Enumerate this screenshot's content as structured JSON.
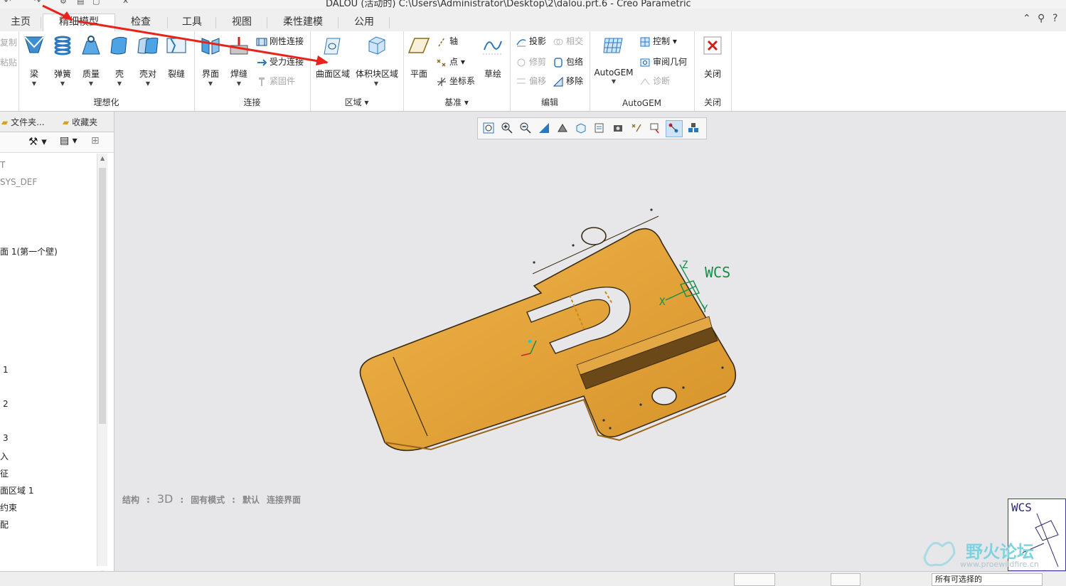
{
  "window": {
    "title": "DALOU (活动的) C:\\Users\\Administrator\\Desktop\\2\\dalou.prt.6 - Creo Parametric"
  },
  "tabs": [
    {
      "label": "主页"
    },
    {
      "label": "精细模型"
    },
    {
      "label": "检查"
    },
    {
      "label": "工具"
    },
    {
      "label": "视图"
    },
    {
      "label": "柔性建模"
    },
    {
      "label": "公用"
    }
  ],
  "ribbon": {
    "left_fragments": {
      "copy": "复制",
      "paste": "粘贴"
    },
    "idealize": {
      "group_label": "理想化",
      "buttons": [
        {
          "label": "梁"
        },
        {
          "label": "弹簧"
        },
        {
          "label": "质量"
        },
        {
          "label": "壳"
        },
        {
          "label": "壳对"
        },
        {
          "label": "裂缝"
        }
      ]
    },
    "connect": {
      "group_label": "连接",
      "buttons": [
        {
          "label": "界面"
        },
        {
          "label": "焊缝"
        }
      ],
      "small": [
        {
          "label": "刚性连接"
        },
        {
          "label": "受力连接"
        },
        {
          "label": "紧固件"
        }
      ]
    },
    "region": {
      "group_label": "区域",
      "buttons": [
        {
          "label": "曲面区域"
        },
        {
          "label": "体积块区域"
        }
      ]
    },
    "datum": {
      "group_label": "基准",
      "buttons": [
        {
          "label": "平面"
        },
        {
          "label": "草绘"
        }
      ],
      "small": [
        {
          "label": "轴"
        },
        {
          "label": "点"
        },
        {
          "label": "坐标系"
        }
      ]
    },
    "edit": {
      "group_label": "编辑",
      "small": [
        {
          "label": "投影"
        },
        {
          "label": "相交"
        },
        {
          "label": "修剪"
        },
        {
          "label": "包络"
        },
        {
          "label": "偏移"
        },
        {
          "label": "移除"
        }
      ]
    },
    "autogem": {
      "group_label": "AutoGEM",
      "buttons": [
        {
          "label": "AutoGEM"
        }
      ],
      "small": [
        {
          "label": "控制"
        },
        {
          "label": "审阅几何"
        },
        {
          "label": "诊断"
        }
      ]
    },
    "close": {
      "group_label": "关闭",
      "buttons": [
        {
          "label": "关闭"
        }
      ]
    }
  },
  "left_panel": {
    "tabs": [
      {
        "label": "文件夹..."
      },
      {
        "label": "收藏夹"
      }
    ],
    "tree": [
      {
        "label": "T"
      },
      {
        "label": "SYS_DEF"
      },
      {
        "label": "面 1(第一个壁)"
      },
      {
        "label": "1"
      },
      {
        "label": "2"
      },
      {
        "label": "3"
      },
      {
        "label": "入"
      },
      {
        "label": "征"
      },
      {
        "label": "面区域 1"
      },
      {
        "label": "约束"
      },
      {
        "label": "配"
      }
    ]
  },
  "viewport": {
    "info": [
      "结构",
      ":",
      "3D",
      ":",
      "固有模式",
      ":",
      "默认",
      "连接界面"
    ],
    "csys_label": "WCS",
    "triad_label": "WCS",
    "axis_z": "Z",
    "axis_x": "X",
    "axis_y": "Y"
  },
  "statusbar": {
    "right_text": "所有可选择的"
  },
  "watermark": {
    "text": "野火论坛",
    "url": "www.proewildfire.cn"
  },
  "colors": {
    "part_fill": "#e2a33a",
    "part_edge": "#3a2a10",
    "csys_green": "#1a8a4a",
    "arrow_red": "#e8231c",
    "close_red": "#d0201a"
  }
}
